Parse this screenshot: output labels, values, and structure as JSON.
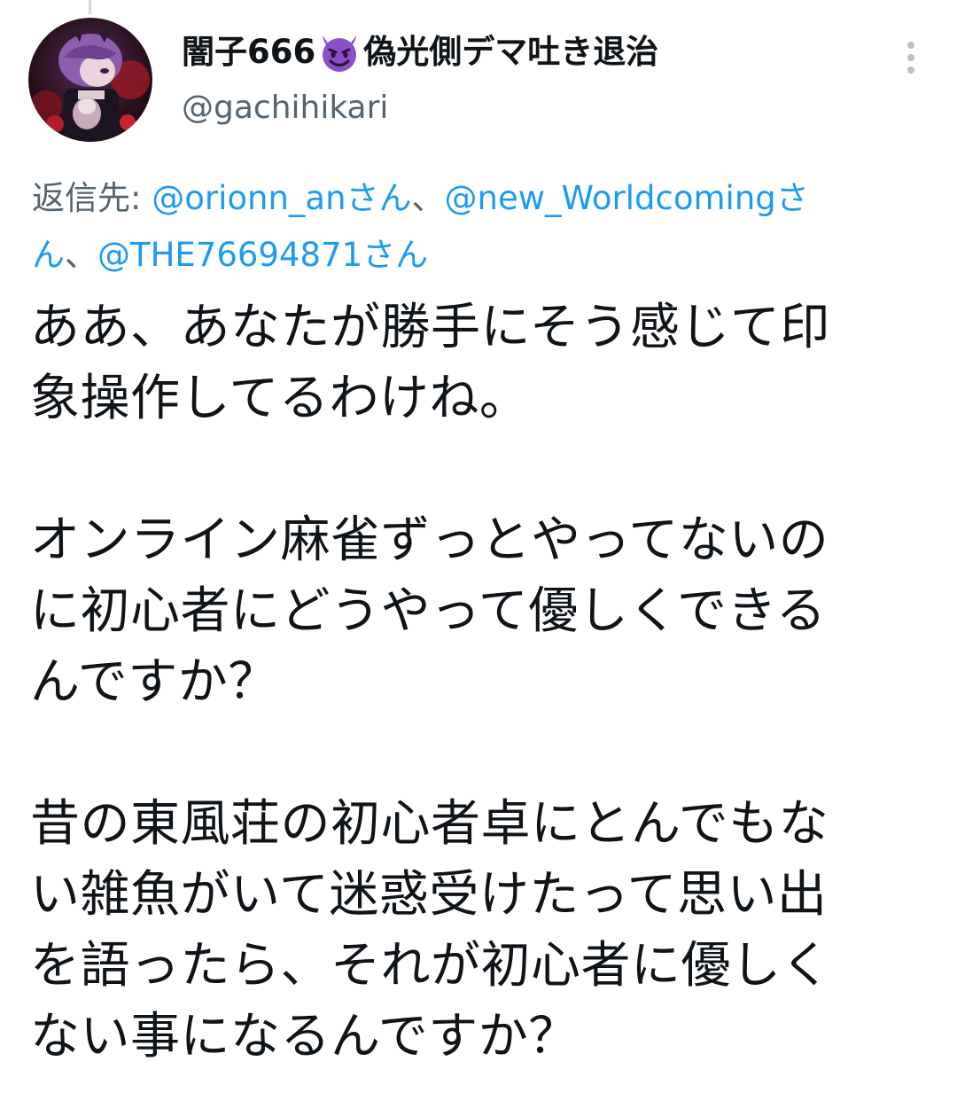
{
  "author": {
    "display_name_before": "闇子666",
    "emoji_icon": "smiling-devil-icon",
    "display_name_after": "偽光側デマ吐き退治",
    "handle": "@gachihikari"
  },
  "reply_to": {
    "prefix": "返信先: ",
    "mentions": [
      "@orionn_anさん",
      "@new_Worldcomingさん",
      "@THE76694871さん"
    ],
    "separator": "、"
  },
  "tweet": {
    "paragraphs": [
      [
        "ああ、あなたが勝手にそう感じて印",
        "象操作してるわけね。"
      ],
      [
        "オンライン麻雀ずっとやってないの",
        "に初心者にどうやって優しくできる",
        "んですか？"
      ],
      [
        "昔の東風荘の初心者卓にとんでもな",
        "い雑魚がいて迷惑受けたって思い出",
        "を語ったら、それが初心者に優しく",
        "ない事になるんですか？"
      ]
    ]
  },
  "colors": {
    "text": "#0f1419",
    "secondary": "#536471",
    "link": "#1d9bf0",
    "emoji": "#8b4fc7"
  }
}
